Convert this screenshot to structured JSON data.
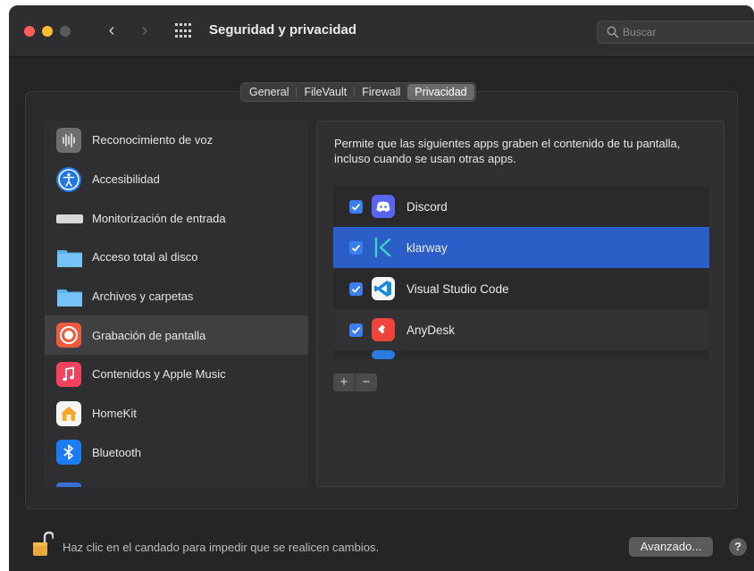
{
  "window": {
    "title": "Seguridad y privacidad",
    "back_icon": "‹",
    "forward_icon": "›"
  },
  "search": {
    "placeholder": "Buscar"
  },
  "tabs": [
    {
      "label": "General",
      "selected": false
    },
    {
      "label": "FileVault",
      "selected": false
    },
    {
      "label": "Firewall",
      "selected": false
    },
    {
      "label": "Privacidad",
      "selected": true
    }
  ],
  "sidebar": {
    "items": [
      {
        "label": "Reconocimiento de voz",
        "icon": "waveform-icon"
      },
      {
        "label": "Accesibilidad",
        "icon": "accessibility-icon"
      },
      {
        "label": "Monitorización de entrada",
        "icon": "keyboard-icon"
      },
      {
        "label": "Acceso total al disco",
        "icon": "folder-icon"
      },
      {
        "label": "Archivos y carpetas",
        "icon": "folder-icon"
      },
      {
        "label": "Grabación de pantalla",
        "icon": "screen-record-icon",
        "selected": true
      },
      {
        "label": "Contenidos y Apple Music",
        "icon": "music-icon"
      },
      {
        "label": "HomeKit",
        "icon": "home-icon"
      },
      {
        "label": "Bluetooth",
        "icon": "bluetooth-icon"
      }
    ]
  },
  "panel": {
    "description": "Permite que las siguientes apps graben el contenido de tu pantalla, incluso cuando se usan otras apps.",
    "apps": [
      {
        "label": "Discord",
        "checked": true,
        "icon": "discord-icon"
      },
      {
        "label": "klarway",
        "checked": true,
        "icon": "klarway-icon",
        "selected": true
      },
      {
        "label": "Visual Studio Code",
        "checked": true,
        "icon": "vscode-icon"
      },
      {
        "label": "AnyDesk",
        "checked": true,
        "icon": "anydesk-icon"
      }
    ],
    "add_label": "+",
    "remove_label": "−"
  },
  "footer": {
    "lock_text": "Haz clic en el candado para impedir que se realicen cambios.",
    "advanced_label": "Avanzado...",
    "help_label": "?"
  },
  "colors": {
    "selection_blue": "#2b5fc7",
    "checkbox_blue": "#3b7ef2",
    "close": "#ff5f57",
    "minimize": "#febc2e"
  }
}
